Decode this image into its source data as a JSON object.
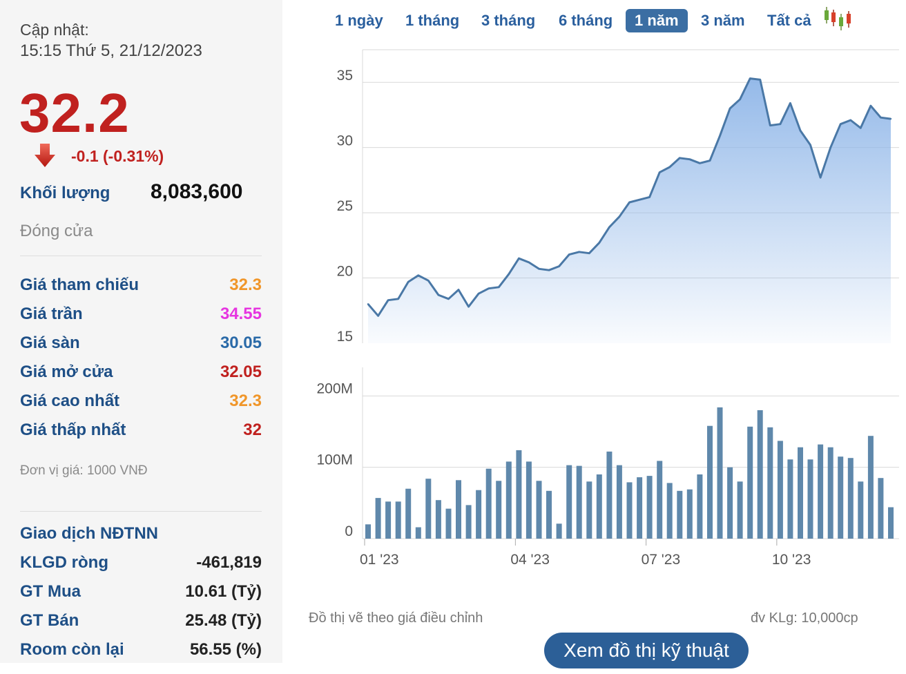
{
  "sidebar": {
    "update_label": "Cập nhật:",
    "update_time": "15:15 Thứ 5, 21/12/2023",
    "price": "32.2",
    "change": "-0.1 (-0.31%)",
    "volume_label": "Khối lượng",
    "volume_value": "8,083,600",
    "status": "Đóng cửa",
    "stats": [
      {
        "label": "Giá tham chiếu",
        "value": "32.3",
        "color": "#f0962a"
      },
      {
        "label": "Giá trần",
        "value": "34.55",
        "color": "#e635e0"
      },
      {
        "label": "Giá sàn",
        "value": "30.05",
        "color": "#2a6aa8"
      },
      {
        "label": "Giá mở cửa",
        "value": "32.05",
        "color": "#c0211f"
      },
      {
        "label": "Giá cao nhất",
        "value": "32.3",
        "color": "#f0962a"
      },
      {
        "label": "Giá thấp nhất",
        "value": "32",
        "color": "#c0211f"
      }
    ],
    "unit": "Đơn vị giá: 1000 VNĐ",
    "foreign": {
      "title": "Giao dịch NĐTNN",
      "rows": [
        {
          "label": "KLGD ròng",
          "value": "-461,819"
        },
        {
          "label": "GT Mua",
          "value": "10.61 (Tỷ)"
        },
        {
          "label": "GT Bán",
          "value": "25.48 (Tỷ)"
        },
        {
          "label": "Room còn lại",
          "value": "56.55 (%)"
        }
      ]
    }
  },
  "tabs": {
    "items": [
      "1 ngày",
      "1 tháng",
      "3 tháng",
      "6 tháng",
      "1 năm",
      "3 năm",
      "Tất cả"
    ],
    "active": "1 năm"
  },
  "icons": {
    "candle": "candlestick-chart-icon",
    "down": "down-arrow-icon"
  },
  "colors": {
    "line": "#4a78a6",
    "fill_top": "#8fb6e8",
    "bar": "#5f88ab",
    "accent_red": "#c0211f",
    "label_blue": "#1e4f86"
  },
  "chart_data": [
    {
      "type": "area",
      "x_ticks": [
        "01 '23",
        "04 '23",
        "07 '23",
        "10 '23"
      ],
      "ylim": [
        15,
        37.5
      ],
      "y_ticks": [
        15,
        20,
        25,
        30,
        35
      ],
      "grid": true,
      "values": [
        18.0,
        17.1,
        18.3,
        18.4,
        19.7,
        20.2,
        19.8,
        18.7,
        18.4,
        19.1,
        17.8,
        18.8,
        19.2,
        19.3,
        20.3,
        21.5,
        21.2,
        20.7,
        20.6,
        20.9,
        21.8,
        22.0,
        21.9,
        22.7,
        23.9,
        24.7,
        25.8,
        26.0,
        26.2,
        28.1,
        28.5,
        29.2,
        29.1,
        28.8,
        29.0,
        30.9,
        33.0,
        33.7,
        35.3,
        35.2,
        31.7,
        31.8,
        33.4,
        31.3,
        30.2,
        27.7,
        30.0,
        31.8,
        32.1,
        31.5,
        33.2,
        32.3,
        32.2
      ]
    },
    {
      "type": "bar",
      "x_ticks": [
        "01 '23",
        "04 '23",
        "07 '23",
        "10 '23"
      ],
      "ylim": [
        0,
        240
      ],
      "y_ticks": [
        "0",
        "100M",
        "200M"
      ],
      "y_tick_values": [
        0,
        100,
        200
      ],
      "values": [
        20,
        57,
        52,
        52,
        70,
        16,
        84,
        54,
        42,
        82,
        47,
        68,
        98,
        81,
        108,
        124,
        108,
        81,
        67,
        21,
        103,
        102,
        80,
        90,
        122,
        103,
        79,
        86,
        88,
        109,
        78,
        67,
        69,
        90,
        158,
        184,
        100,
        80,
        157,
        180,
        156,
        137,
        111,
        128,
        111,
        132,
        128,
        115,
        113,
        80,
        144,
        85,
        44
      ]
    }
  ],
  "notes": {
    "left": "Đồ thị vẽ theo giá điều chỉnh",
    "right": "đv KLg: 10,000cp",
    "button": "Xem đồ thị kỹ thuật"
  }
}
